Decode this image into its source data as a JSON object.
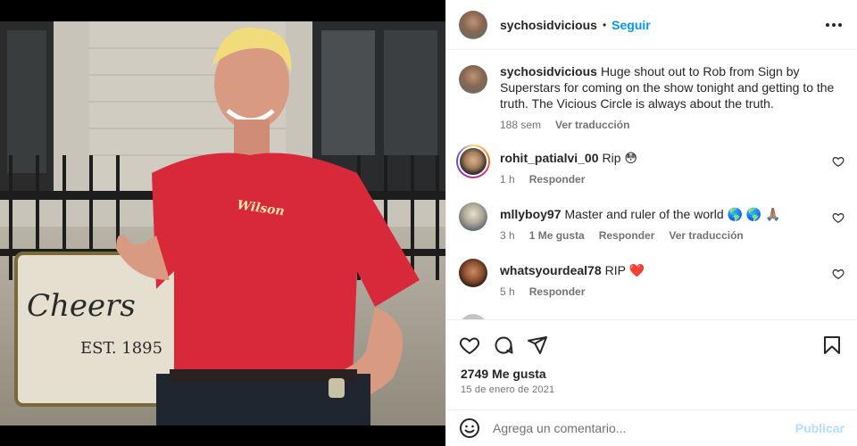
{
  "post": {
    "username": "sychosidvicious",
    "follow_label": "Seguir",
    "separator": "•",
    "photo": {
      "sign_text": "Cheers",
      "est_text": "EST. 1895",
      "shirt_logo": "Wilson"
    }
  },
  "caption": {
    "username": "sychosidvicious",
    "text": "Huge shout out to Rob from Sign by Superstars for coming on the show tonight and getting to the truth. The Vicious Circle is always about the truth.",
    "time": "188 sem",
    "translate_label": "Ver traducción"
  },
  "comments": [
    {
      "username": "rohit_patialvi_00",
      "text": "Rip 😳",
      "time": "1 h",
      "reply_label": "Responder"
    },
    {
      "username": "mllyboy97",
      "text": "Master and ruler of the world 🌎 🌎 🙏🏽",
      "time": "3 h",
      "likes_label": "1 Me gusta",
      "reply_label": "Responder",
      "translate_label": "Ver traducción"
    },
    {
      "username": "whatsyourdeal78",
      "text": "RIP ❤️",
      "time": "5 h",
      "reply_label": "Responder"
    }
  ],
  "actions": {
    "likes": "2749 Me gusta",
    "date": "15 de enero de 2021"
  },
  "add_comment": {
    "placeholder": "Agrega un comentario...",
    "publish_label": "Publicar"
  },
  "icons": {
    "more": "more-options-icon",
    "like": "heart-icon",
    "comment": "comment-icon",
    "share": "share-icon",
    "save": "bookmark-icon",
    "emoji": "emoji-icon"
  },
  "colors": {
    "accent": "#0095f6",
    "publish_disabled": "#b2dffc",
    "shirt": "#d8293b",
    "heart_red": "#ed4956"
  }
}
